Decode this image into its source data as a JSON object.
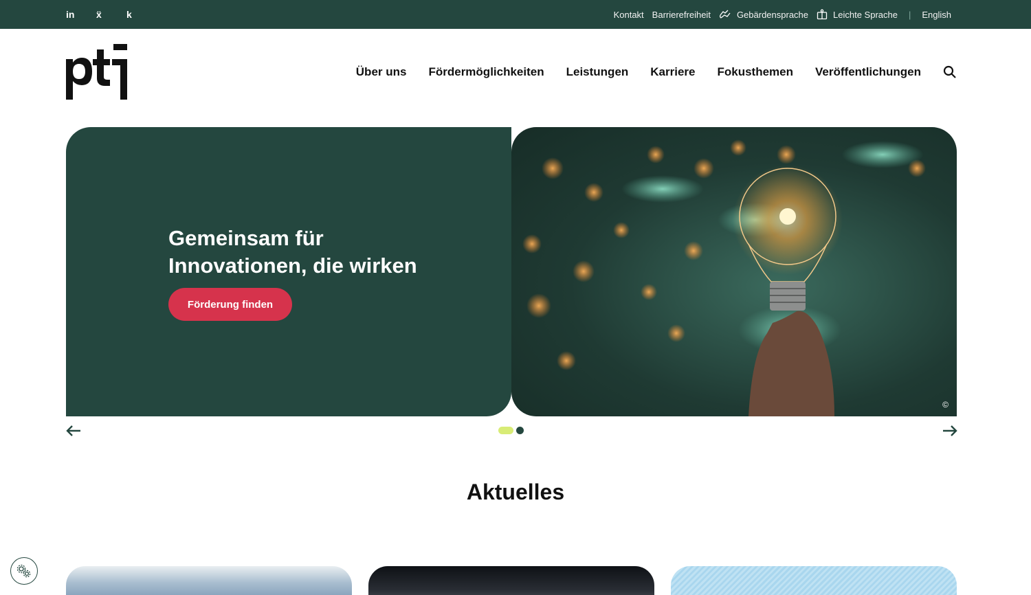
{
  "topbar": {
    "social": [
      {
        "label": "in",
        "icon": "linkedin-icon"
      },
      {
        "label": "ẍ",
        "icon": "xing-icon"
      },
      {
        "label": "k",
        "icon": "kununu-icon"
      }
    ],
    "links": {
      "kontakt": "Kontakt",
      "barrierefreiheit": "Barrierefreiheit",
      "gebaerdensprache": "Gebärdensprache",
      "leichte_sprache": "Leichte Sprache",
      "separator": "|",
      "english": "English"
    }
  },
  "header": {
    "logo_text": "ptj",
    "nav": [
      "Über uns",
      "Fördermöglichkeiten",
      "Leistungen",
      "Karriere",
      "Fokusthemen",
      "Veröffentlichungen"
    ]
  },
  "hero": {
    "title": "Gemeinsam für Innovationen, die wirken",
    "cta": "Förderung finden",
    "copyright": "©",
    "slides_total": 2,
    "slide_active": 1
  },
  "section": {
    "title": "Aktuelles"
  },
  "colors": {
    "brand_dark": "#24473f",
    "cta_red": "#d6334c",
    "dot_active": "#d8ec76"
  }
}
